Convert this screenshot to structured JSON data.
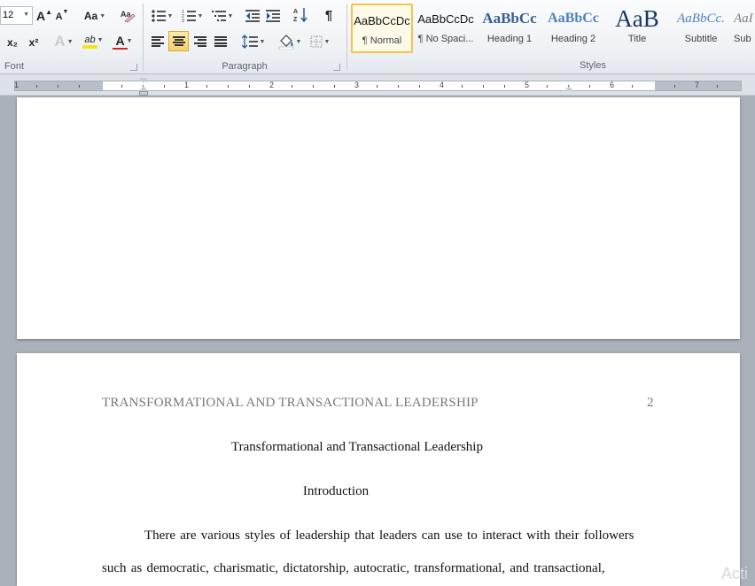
{
  "ribbon": {
    "font_size": "12",
    "font_group_label": "Font",
    "paragraph_group_label": "Paragraph",
    "styles_group_label": "Styles",
    "font_buttons": {
      "grow": "A",
      "shrink": "A",
      "change_case": "Aa",
      "subscript": "x₂",
      "superscript": "x²",
      "text_effects": "A",
      "highlight": "ab",
      "font_color": "A"
    },
    "pilcrow": "¶",
    "highlight_color": "#f5e51c",
    "font_color": "#d4261f"
  },
  "styles": [
    {
      "sample": "AaBbCcDc",
      "name": "¶ Normal",
      "selected": true
    },
    {
      "sample": "AaBbCcDc",
      "name": "¶ No Spaci...",
      "selected": false
    },
    {
      "sample": "AaBbCc",
      "name": "Heading 1",
      "selected": false
    },
    {
      "sample": "AaBbCc",
      "name": "Heading 2",
      "selected": false
    },
    {
      "sample": "AaB",
      "name": "Title",
      "selected": false
    },
    {
      "sample": "AaBbCc.",
      "name": "Subtitle",
      "selected": false
    },
    {
      "sample": "AaI",
      "name": "Sub",
      "selected": false
    }
  ],
  "ruler": {
    "numbers": [
      "1",
      "1",
      "2",
      "3",
      "4",
      "5",
      "6",
      "7"
    ]
  },
  "document": {
    "running_head": "TRANSFORMATIONAL AND TRANSACTIONAL LEADERSHIP",
    "page_number": "2",
    "title": "Transformational and Transactional Leadership",
    "heading": "Introduction",
    "line1": "There are various styles of leadership that leaders can use to interact with their followers",
    "line2": "such as democratic, charismatic, dictatorship, autocratic, transformational, and transactional,"
  },
  "watermark": "Acti"
}
